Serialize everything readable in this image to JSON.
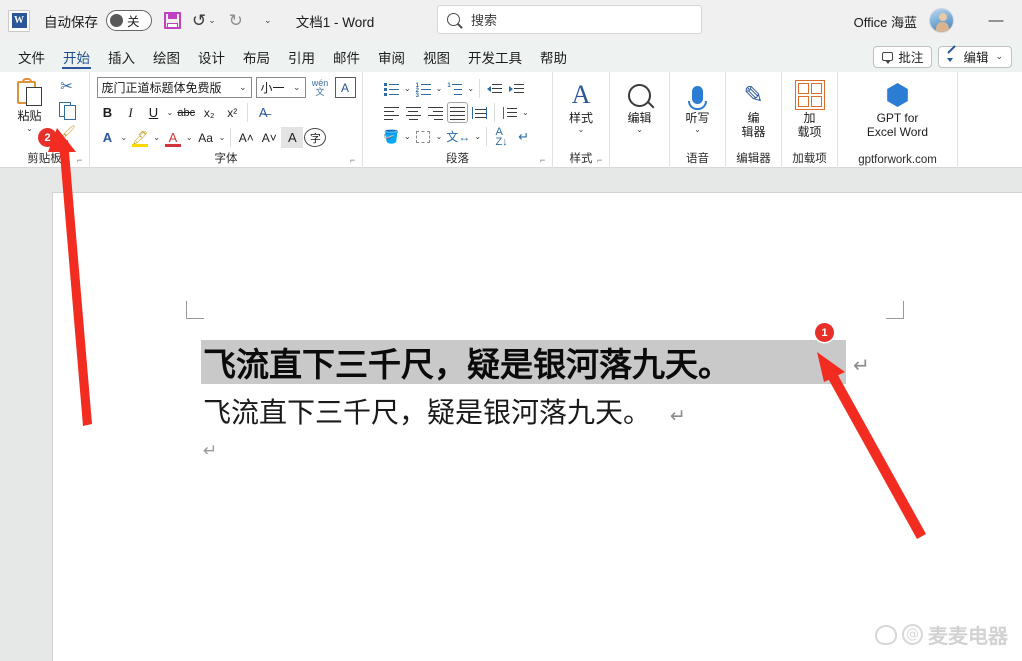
{
  "titlebar": {
    "app_icon": "word-logo-icon",
    "autosave_label": "自动保存",
    "autosave_state": "关",
    "save_icon": "save-icon",
    "undo_icon": "undo-icon",
    "redo_icon": "redo-icon",
    "qat_more_icon": "chevron-down-icon",
    "document_title": "文档1  -  Word",
    "search_placeholder": "搜索",
    "search_icon": "search-icon",
    "account_name": "Office 海蓝",
    "avatar": "user-avatar",
    "minimize_label": "—"
  },
  "tabs": [
    {
      "label": "文件",
      "active": false
    },
    {
      "label": "开始",
      "active": true
    },
    {
      "label": "插入",
      "active": false
    },
    {
      "label": "绘图",
      "active": false
    },
    {
      "label": "设计",
      "active": false
    },
    {
      "label": "布局",
      "active": false
    },
    {
      "label": "引用",
      "active": false
    },
    {
      "label": "邮件",
      "active": false
    },
    {
      "label": "审阅",
      "active": false
    },
    {
      "label": "视图",
      "active": false
    },
    {
      "label": "开发工具",
      "active": false
    },
    {
      "label": "帮助",
      "active": false
    }
  ],
  "tabbar_right": {
    "comment_label": "批注",
    "comment_icon": "comment-icon",
    "edit_label": "编辑",
    "edit_icon": "pencil-icon",
    "edit_chevron": "⌄"
  },
  "ribbon": {
    "clipboard": {
      "group_label": "剪贴板",
      "paste_label": "粘贴",
      "paste_icon": "clipboard-paste-icon",
      "cut_icon": "scissors-icon",
      "copy_icon": "copy-icon",
      "format_painter_icon": "format-painter-icon",
      "dialog_launcher": "⌐",
      "badge": "2"
    },
    "font": {
      "group_label": "字体",
      "font_name": "庞门正道标题体免费版",
      "font_size": "小一",
      "phonetic_icon": "phonetic-guide-icon",
      "border_icon": "character-border-icon",
      "bold": "B",
      "italic": "I",
      "underline": "U",
      "strikethrough": "abc",
      "subscript": "x₂",
      "superscript": "x²",
      "clear_format_icon": "clear-formatting-icon",
      "text_effects": "A",
      "highlight": "A",
      "font_color": "A",
      "change_case": "Aa",
      "grow_font": "A˄",
      "shrink_font": "A˅",
      "char_shading": "A",
      "enclose_char": "字",
      "dialog_launcher": "⌐"
    },
    "paragraph": {
      "group_label": "段落",
      "bullets_icon": "bullet-list-icon",
      "numbering_icon": "numbered-list-icon",
      "multilevel_icon": "multilevel-list-icon",
      "decrease_indent_icon": "decrease-indent-icon",
      "increase_indent_icon": "increase-indent-icon",
      "align_left_icon": "align-left-icon",
      "align_center_icon": "align-center-icon",
      "align_right_icon": "align-right-icon",
      "justify_icon": "justify-icon",
      "distribute_icon": "distribute-icon",
      "line_spacing_icon": "line-spacing-icon",
      "shading_icon": "shading-icon",
      "borders_icon": "borders-icon",
      "chinese_layout_icon": "chinese-layout-icon",
      "sort_icon": "sort-icon",
      "show_marks_icon": "show-paragraph-marks-icon",
      "dialog_launcher": "⌐"
    },
    "styles": {
      "group_label": "样式",
      "button_label": "样式",
      "icon": "styles-icon",
      "chevron": "⌄",
      "dialog_launcher": "⌐"
    },
    "editing": {
      "button_label": "编辑",
      "icon": "find-magnifier-icon",
      "chevron": "⌄"
    },
    "voice": {
      "group_label": "语音",
      "button_label": "听写",
      "icon": "microphone-icon",
      "chevron": "⌄"
    },
    "editor": {
      "group_label": "编辑器",
      "button_label": "编\n辑器",
      "button_label_l1": "编",
      "button_label_l2": "辑器",
      "icon": "editor-pen-icon"
    },
    "addins": {
      "group_label": "加载项",
      "button_label_l1": "加",
      "button_label_l2": "载项",
      "icon": "addins-grid-icon"
    },
    "gpt": {
      "group_label": "gptforwork.com",
      "button_label_l1": "GPT for",
      "button_label_l2": "Excel Word",
      "icon": "gpt-hex-icon"
    }
  },
  "document": {
    "line1_text": "飞流直下三千尺，疑是银河落九天。",
    "line1_pilcrow": "↵",
    "line2_text": "飞流直下三千尺，疑是银河落九天。",
    "line2_pilcrow": "↵",
    "line3_pilcrow": "↵",
    "selection_color": "#c9c9c9"
  },
  "annotations": [
    {
      "id": "1",
      "target": "end-of-first-line",
      "color": "#e8302a"
    },
    {
      "id": "2",
      "target": "format-painter-button",
      "color": "#e8302a"
    }
  ],
  "watermark": {
    "paw_icon": "baidu-paw-icon",
    "at_icon": "at-sign-icon",
    "text": "麦麦电器"
  }
}
